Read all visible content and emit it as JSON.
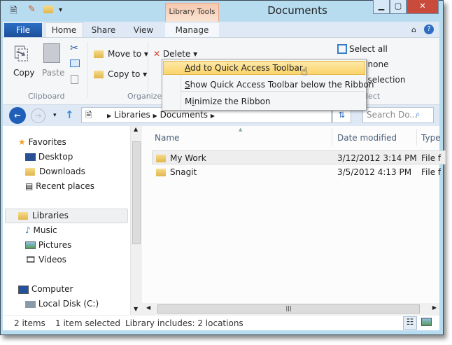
{
  "window": {
    "title": "Documents",
    "context_tab": "Library Tools",
    "controls": [
      "minimize",
      "maximize",
      "close"
    ]
  },
  "tabs": {
    "file": "File",
    "home": "Home",
    "share": "Share",
    "view": "View",
    "manage": "Manage"
  },
  "ribbon": {
    "copy": "Copy",
    "paste": "Paste",
    "move_to": "Move to",
    "copy_to": "Copy to",
    "delete": "Delete",
    "select_all": "Select all",
    "select_none": "t none",
    "invert_selection": "t selection",
    "groups": {
      "clipboard": "Clipboard",
      "organize": "Organize",
      "select": "lect"
    }
  },
  "context_menu": {
    "items": [
      {
        "pre": "",
        "key": "A",
        "post": "dd to Quick Access Toolbar",
        "highlighted": true
      },
      {
        "pre": "",
        "key": "S",
        "post": "how Quick Access Toolbar below the Ribbon"
      },
      {
        "pre": "M",
        "key": "i",
        "post": "nimize the Ribbon"
      }
    ]
  },
  "address": {
    "crumbs": [
      "Libraries",
      "Documents"
    ],
    "search_placeholder": "Search Do..."
  },
  "nav": {
    "favorites": "Favorites",
    "fav_items": [
      "Desktop",
      "Downloads",
      "Recent places"
    ],
    "libraries": "Libraries",
    "lib_items": [
      "Music",
      "Pictures",
      "Videos"
    ],
    "computer": "Computer",
    "comp_items": [
      "Local Disk (C:)"
    ]
  },
  "list": {
    "columns": [
      "Name",
      "Date modified",
      "Type"
    ],
    "rows": [
      {
        "name": "My Work",
        "date": "3/12/2012 3:14 PM",
        "type": "File f",
        "selected": true
      },
      {
        "name": "Snagit",
        "date": "3/5/2012 4:13 PM",
        "type": "File f"
      }
    ]
  },
  "status": {
    "count": "2 items",
    "selected": "1 item selected",
    "library": "Library includes: 2 locations"
  },
  "colors": {
    "frame": "#b7dcf0",
    "file_tab": "#1d5aa8",
    "highlight": "#fbd97a",
    "context_tab": "#f6c9ad"
  }
}
